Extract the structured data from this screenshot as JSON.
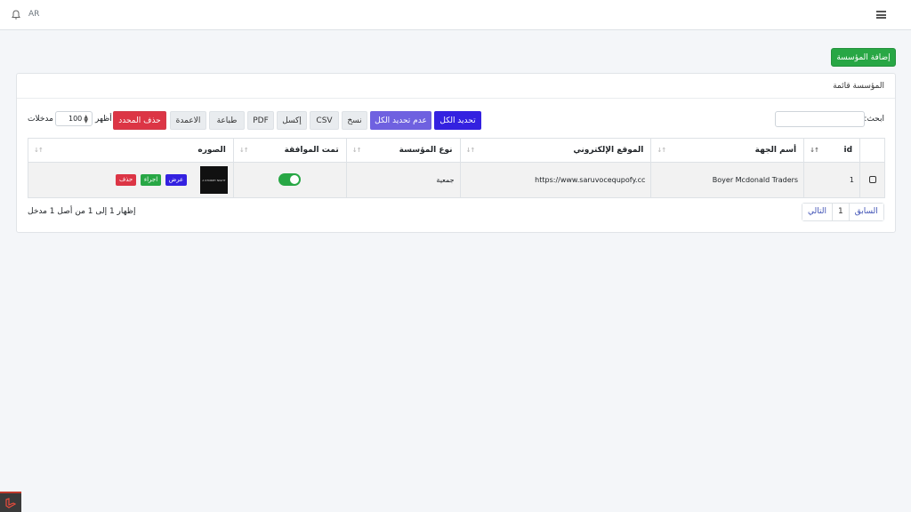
{
  "topbar": {
    "lang": "AR",
    "bell_icon": "bell-icon",
    "menu_icon": "hamburger-menu-icon"
  },
  "add_button": "إضافة المؤسسة",
  "card": {
    "title": "المؤسسة قائمة"
  },
  "controls": {
    "show_label": "أظهر",
    "entries_label": "مدخلات",
    "page_length": "100",
    "search_label": "ابحث:",
    "search_value": ""
  },
  "buttons": {
    "select_all": "تحديد الكل",
    "deselect_all": "عدم تحديد الكل",
    "copy": "نسخ",
    "csv": "CSV",
    "excel": "إكسل",
    "pdf": "PDF",
    "print": "طباعة",
    "columns": "الاعمدة",
    "delete_selected": "حذف المحدد"
  },
  "colors": {
    "primary": "#3421e0",
    "secondary": "#6f61e0",
    "success": "#28a745",
    "danger": "#dc3545"
  },
  "table": {
    "headers": [
      "id",
      "أسم الجهة",
      "الموقع الإلكتروني",
      "نوع المؤسسة",
      "تمت الموافقة",
      "الصوره"
    ],
    "rows": [
      {
        "id": "1",
        "name": "Boyer Mcdonald Traders",
        "website": "https://www.saruvocequpofy.cc",
        "type": "جمعية",
        "approved": true,
        "image_text": "A STORMY NIGHT",
        "actions": {
          "view": "عرض",
          "procedure": "اجراء",
          "delete": "حذف"
        }
      }
    ]
  },
  "footer": {
    "info": "إظهار 1 إلى 1 من أصل 1 مدخل",
    "pagination": {
      "previous": "السابق",
      "page": "1",
      "next": "التالي"
    }
  }
}
